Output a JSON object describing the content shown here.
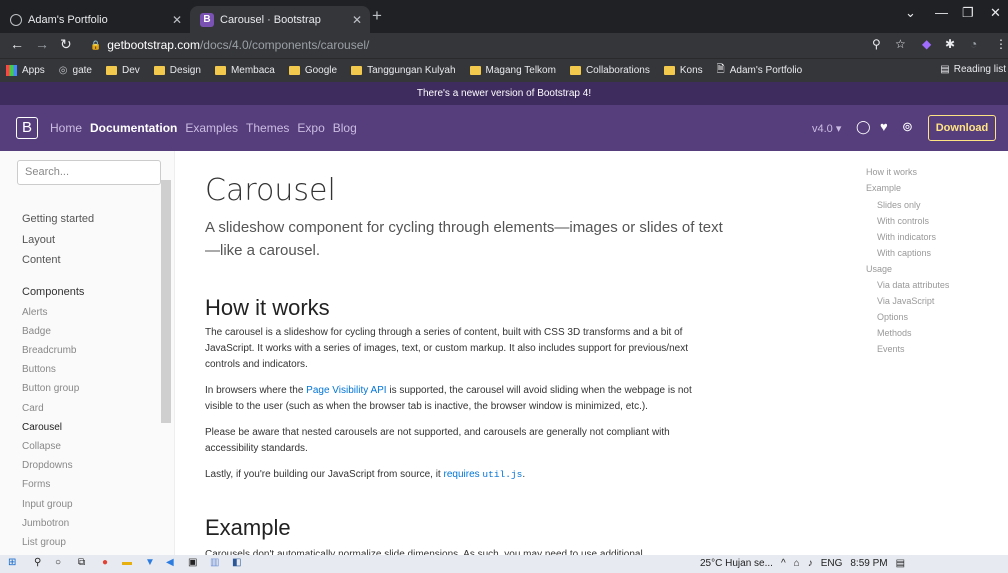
{
  "browser": {
    "tabs": [
      {
        "label": "Adam's Portfolio"
      },
      {
        "label": "Carousel · Bootstrap"
      }
    ],
    "new_tab": "+",
    "url_host": "getbootstrap.com",
    "url_path": "/docs/4.0/components/carousel/",
    "bookmarks": [
      "Apps",
      "gate",
      "Dev",
      "Design",
      "Membaca",
      "Google",
      "Tanggungan Kulyah",
      "Magang Telkom",
      "Collaborations",
      "Kons",
      "Adam's Portfolio"
    ],
    "reading_list": "Reading list"
  },
  "notice": "There's a newer version of Bootstrap 4!",
  "bsnav": {
    "brand": "B",
    "links": [
      "Home",
      "Documentation",
      "Examples",
      "Themes",
      "Expo",
      "Blog"
    ],
    "version": "v4.0 ▾",
    "download": "Download"
  },
  "sidebar": {
    "search_placeholder": "Search...",
    "groups": [
      "Getting started",
      "Layout",
      "Content",
      "Components"
    ],
    "items": [
      "Alerts",
      "Badge",
      "Breadcrumb",
      "Buttons",
      "Button group",
      "Card",
      "Carousel",
      "Collapse",
      "Dropdowns",
      "Forms",
      "Input group",
      "Jumbotron",
      "List group"
    ]
  },
  "main": {
    "title": "Carousel",
    "lead": "A slideshow component for cycling through elements—images or slides of text—like a carousel.",
    "h_how": "How it works",
    "p1": "The carousel is a slideshow for cycling through a series of content, built with CSS 3D transforms and a bit of JavaScript. It works with a series of images, text, or custom markup. It also includes support for previous/next controls and indicators.",
    "p2_a": "In browsers where the ",
    "p2_link": "Page Visibility API",
    "p2_b": " is supported, the carousel will avoid sliding when the webpage is not visible to the user (such as when the browser tab is inactive, the browser window is minimized, etc.).",
    "p3": "Please be aware that nested carousels are not supported, and carousels are generally not compliant with accessibility standards.",
    "p4_a": "Lastly, if you're building our JavaScript from source, it ",
    "p4_link": "requires",
    "p4_code": "util.js",
    "p4_end": ".",
    "h_example": "Example",
    "p5": "Carousels don't automatically normalize slide dimensions. As such, you may need to use additional"
  },
  "toc": [
    "How it works",
    "Example",
    "Slides only",
    "With controls",
    "With indicators",
    "With captions",
    "Usage",
    "Via data attributes",
    "Via JavaScript",
    "Options",
    "Methods",
    "Events"
  ],
  "taskbar": {
    "weather": "25°C  Hujan se...",
    "lang": "ENG",
    "time": "8:59 PM"
  }
}
